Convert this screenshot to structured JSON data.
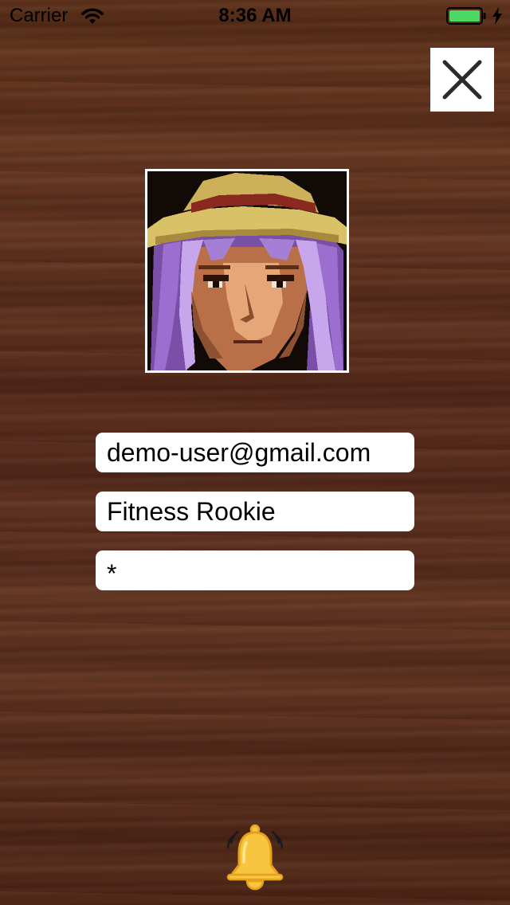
{
  "status_bar": {
    "carrier": "Carrier",
    "time": "8:36 AM",
    "battery_color": "#4cd964"
  },
  "profile": {
    "avatar_icon": "pixel-art-character-portrait",
    "email": "demo-user@gmail.com",
    "username": "Fitness Rookie",
    "password_masked": "*"
  },
  "icons": {
    "close": "close-icon",
    "bell": "ringing-bell-icon"
  },
  "colors": {
    "background_wood": "#5b2e17",
    "field_background": "#ffffff",
    "bell_fill": "#f7c53f",
    "bell_outline": "#e8a21a"
  }
}
